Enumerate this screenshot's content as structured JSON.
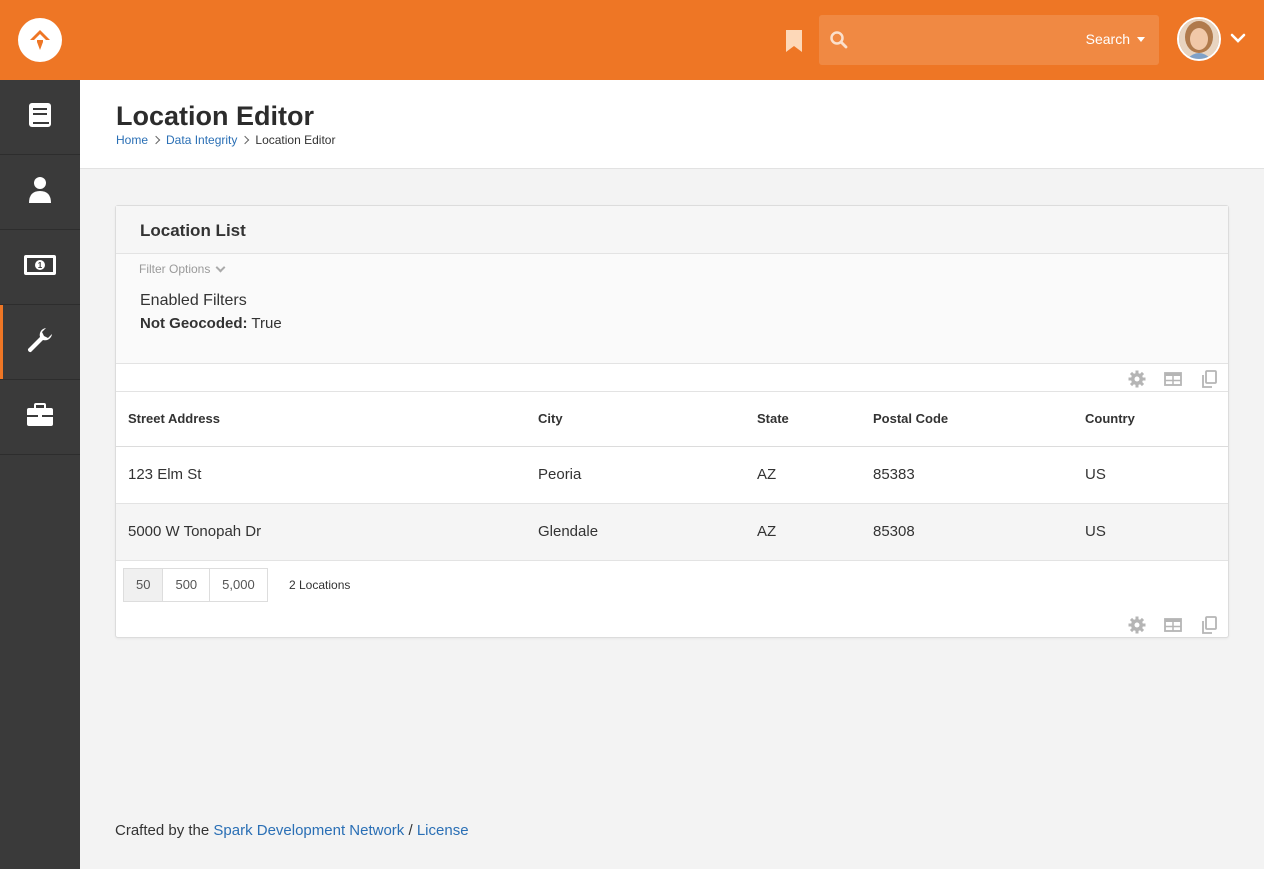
{
  "header": {
    "search_placeholder": "",
    "search_type": "Search"
  },
  "page": {
    "title": "Location Editor",
    "breadcrumb": [
      "Home",
      "Data Integrity",
      "Location Editor"
    ]
  },
  "panel": {
    "title": "Location List",
    "filter_toggle": "Filter Options",
    "enabled_filters_title": "Enabled Filters",
    "filter_label": "Not Geocoded:",
    "filter_value": "True"
  },
  "grid": {
    "columns": [
      "Street Address",
      "City",
      "State",
      "Postal Code",
      "Country"
    ],
    "rows": [
      [
        "123 Elm St",
        "Peoria",
        "AZ",
        "85383",
        "US"
      ],
      [
        "5000 W Tonopah Dr",
        "Glendale",
        "AZ",
        "85308",
        "US"
      ]
    ],
    "page_sizes": [
      "50",
      "500",
      "5,000"
    ],
    "count_text": "2 Locations"
  },
  "footer": {
    "prefix": "Crafted by the",
    "link1": "Spark Development Network",
    "sep": "/",
    "link2": "License"
  },
  "colors": {
    "brand": "#ee7625",
    "sidebar": "#3a3a3a",
    "link": "#2a6fb5"
  }
}
